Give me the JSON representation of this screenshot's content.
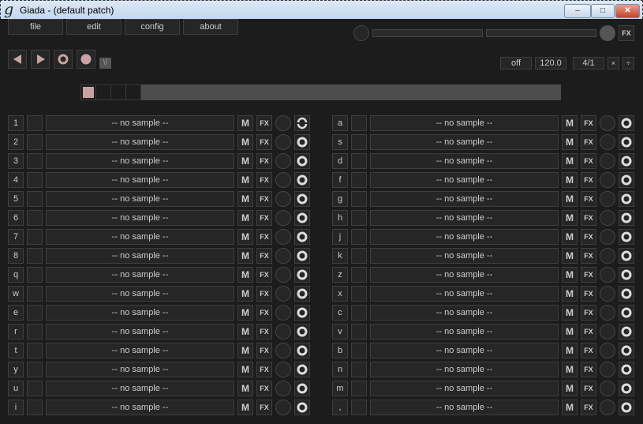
{
  "window": {
    "title": "Giada - (default patch)",
    "logo": "g",
    "minimize": "–",
    "maximize": "□",
    "close": "✕"
  },
  "menu": {
    "file": "file",
    "edit": "edit",
    "config": "config",
    "about": "about"
  },
  "master": {
    "fx_label": "FX"
  },
  "transport": {
    "input_toggle": "\\/"
  },
  "timing": {
    "quantize": "off",
    "bpm": "120.0",
    "beats": "4/1",
    "multiply": "×",
    "divide": "÷"
  },
  "beat_meter": {
    "total_cells": 4,
    "active_cell": 1
  },
  "channels": {
    "sample_label": "-- no sample --",
    "mute_label": "M",
    "fx_label": "FX",
    "left": [
      "1",
      "2",
      "3",
      "4",
      "5",
      "6",
      "7",
      "8",
      "q",
      "w",
      "e",
      "r",
      "t",
      "y",
      "u",
      "i"
    ],
    "right": [
      "a",
      "s",
      "d",
      "f",
      "g",
      "h",
      "j",
      "k",
      "z",
      "x",
      "c",
      "v",
      "b",
      "n",
      "m",
      ","
    ],
    "left_first_mode": "loop-icon"
  }
}
